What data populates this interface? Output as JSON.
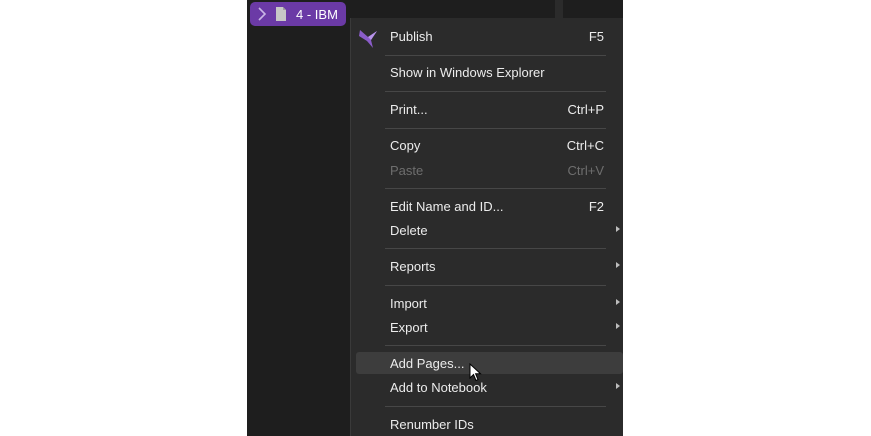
{
  "tree": {
    "item_label": "4 - IBM"
  },
  "menu": {
    "publish": {
      "label": "Publish",
      "shortcut": "F5"
    },
    "show_in_explorer": {
      "label": "Show in Windows Explorer"
    },
    "print": {
      "label": "Print...",
      "shortcut": "Ctrl+P"
    },
    "copy": {
      "label": "Copy",
      "shortcut": "Ctrl+C"
    },
    "paste": {
      "label": "Paste",
      "shortcut": "Ctrl+V"
    },
    "edit_name": {
      "label": "Edit Name and ID...",
      "shortcut": "F2"
    },
    "delete": {
      "label": "Delete"
    },
    "reports": {
      "label": "Reports"
    },
    "import": {
      "label": "Import"
    },
    "export": {
      "label": "Export"
    },
    "add_pages": {
      "label": "Add Pages..."
    },
    "add_to_notebook": {
      "label": "Add to Notebook"
    },
    "renumber_ids": {
      "label": "Renumber IDs"
    }
  },
  "colors": {
    "accent": "#6b3aa6",
    "menu_bg": "#2b2b2b",
    "app_bg": "#1e1e1e",
    "hover_bg": "#3d3d3d"
  }
}
